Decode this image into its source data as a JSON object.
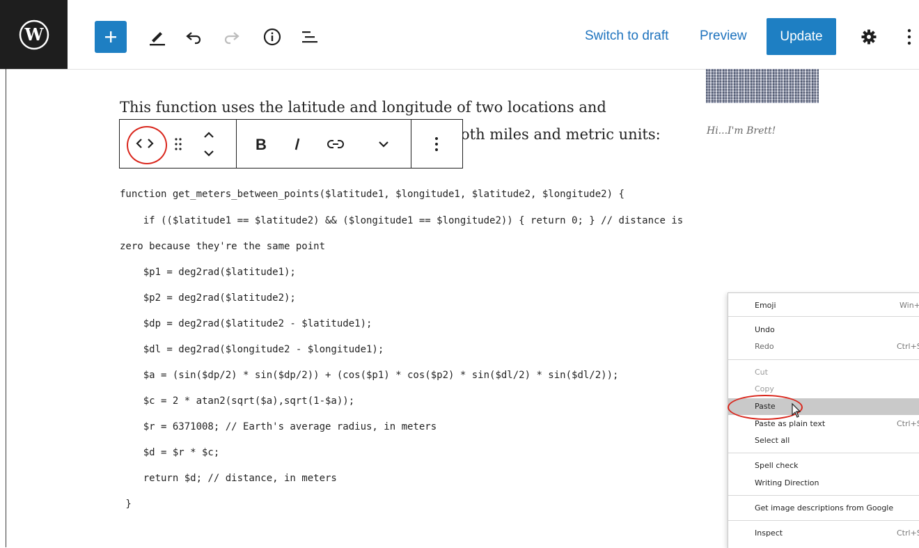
{
  "toolbar": {
    "switch_to_draft": "Switch to draft",
    "preview": "Preview",
    "update": "Update"
  },
  "sidebar": {
    "caption": "Hi...I'm Brett!"
  },
  "content": {
    "paragraph_line1": "This function uses the latitude and longitude of two locations and",
    "paragraph_line2_visible": "oth miles and metric units:"
  },
  "code_lines": [
    "function get_meters_between_points($latitude1, $longitude1, $latitude2, $longitude2) {",
    "    if (($latitude1 == $latitude2) && ($longitude1 == $longitude2)) { return 0; } // distance is",
    "zero because they're the same point",
    "    $p1 = deg2rad($latitude1);",
    "    $p2 = deg2rad($latitude2);",
    "    $dp = deg2rad($latitude2 - $latitude1);",
    "    $dl = deg2rad($longitude2 - $longitude1);",
    "    $a = (sin($dp/2) * sin($dp/2)) + (cos($p1) * cos($p2) * sin($dl/2) * sin($dl/2));",
    "    $c = 2 * atan2(sqrt($a),sqrt(1-$a));",
    "    $r = 6371008; // Earth's average radius, in meters",
    "    $d = $r * $c;",
    "    return $d; // distance, in meters",
    " }"
  ],
  "context_menu": {
    "emoji": "Emoji",
    "emoji_shortcut": "Win+",
    "undo": "Undo",
    "redo": "Redo",
    "redo_shortcut": "Ctrl+S",
    "cut": "Cut",
    "copy": "Copy",
    "paste": "Paste",
    "paste_plain": "Paste as plain text",
    "paste_plain_shortcut": "Ctrl+S",
    "select_all": "Select all",
    "spell_check": "Spell check",
    "writing_direction": "Writing Direction",
    "image_descriptions": "Get image descriptions from Google",
    "inspect": "Inspect",
    "inspect_shortcut": "Ctrl+S"
  },
  "colors": {
    "accent": "#1e7fc3",
    "annotation": "#d9261c",
    "dark": "#1e1e1e"
  }
}
